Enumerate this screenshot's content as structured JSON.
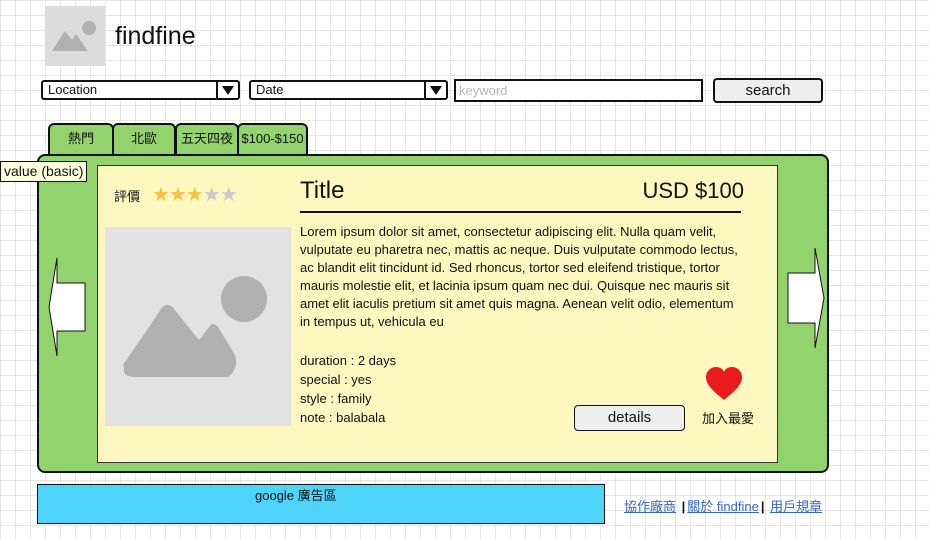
{
  "header": {
    "app_title": "findfine"
  },
  "search": {
    "location_value": "Location",
    "date_value": "Date",
    "keyword_placeholder": "keyword",
    "search_label": "search"
  },
  "tabs": [
    {
      "label": "熱門"
    },
    {
      "label": "北歐"
    },
    {
      "label": "五天四夜"
    },
    {
      "label": "$100-$150"
    }
  ],
  "tooltip": "value (basic)",
  "card": {
    "rating_label": "評價",
    "rating": 3,
    "rating_max": 5,
    "title": "Title",
    "price": "USD $100",
    "description": "Lorem ipsum dolor sit amet, consectetur adipiscing elit. Nulla quam velit, vulputate eu pharetra nec, mattis ac neque. Duis vulputate commodo lectus, ac blandit elit tincidunt id. Sed rhoncus, tortor sed eleifend tristique, tortor mauris molestie elit, et lacinia ipsum quam nec dui. Quisque nec mauris sit amet elit iaculis pretium sit amet quis magna. Aenean velit odio, elementum in tempus ut, vehicula eu",
    "specs": {
      "duration": "duration : 2 days",
      "special": "special : yes",
      "style": "style : family",
      "note": "note : balabala"
    },
    "details_label": "details",
    "favorite_label": "加入最愛"
  },
  "ad": {
    "label": "google 廣告區"
  },
  "footer": {
    "links": [
      {
        "label": "協作廠商"
      },
      {
        "label": "關於 findfine"
      },
      {
        "label": "用戶規章"
      }
    ]
  },
  "colors": {
    "panel_green": "#93d36d",
    "card_yellow": "#fef8c0",
    "ad_blue": "#4dd4f8",
    "star_filled": "#f5c146",
    "star_empty": "#c9c9c9",
    "heart_red": "#e81c1c",
    "link_blue": "#3366cc"
  },
  "icons": {
    "logo": "image-placeholder-icon",
    "thumbnail": "image-placeholder-icon",
    "prev": "arrow-left-icon",
    "next": "arrow-right-icon",
    "dropdown": "triangle-down-icon",
    "favorite": "heart-icon",
    "rating": "star-icon"
  }
}
